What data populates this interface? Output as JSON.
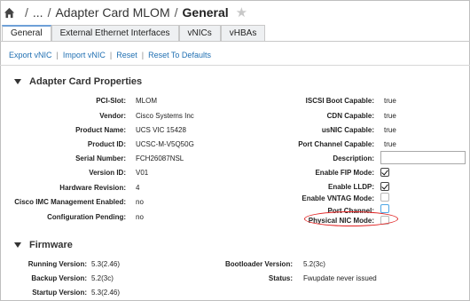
{
  "breadcrumb": {
    "home_icon": "home-icon",
    "ellipsis": "...",
    "parent": "Adapter Card MLOM",
    "current": "General",
    "separator": "/",
    "star_icon": "star-icon"
  },
  "tabs": [
    {
      "label": "General",
      "active": true
    },
    {
      "label": "External Ethernet Interfaces",
      "active": false
    },
    {
      "label": "vNICs",
      "active": false
    },
    {
      "label": "vHBAs",
      "active": false
    }
  ],
  "toolbar": {
    "export": "Export vNIC",
    "import": "Import vNIC",
    "reset": "Reset",
    "reset_defaults": "Reset To Defaults",
    "sep": "|"
  },
  "adapter": {
    "title": "Adapter Card Properties",
    "left": [
      {
        "label": "PCI-Slot:",
        "value": "MLOM"
      },
      {
        "label": "Vendor:",
        "value": "Cisco Systems Inc"
      },
      {
        "label": "Product Name:",
        "value": "UCS VIC 15428"
      },
      {
        "label": "Product ID:",
        "value": "UCSC-M-V5Q50G"
      },
      {
        "label": "Serial Number:",
        "value": "FCH26087NSL"
      },
      {
        "label": "Version ID:",
        "value": "V01"
      },
      {
        "label": "Hardware Revision:",
        "value": "4"
      },
      {
        "label": "Cisco IMC Management Enabled:",
        "value": "no"
      },
      {
        "label": "Configuration Pending:",
        "value": "no"
      }
    ],
    "right_text": [
      {
        "label": "ISCSI Boot Capable:",
        "value": "true"
      },
      {
        "label": "CDN Capable:",
        "value": "true"
      },
      {
        "label": "usNIC Capable:",
        "value": "true"
      },
      {
        "label": "Port Channel Capable:",
        "value": "true"
      }
    ],
    "description_label": "Description:",
    "description_value": "",
    "right_checks": [
      {
        "label": "Enable FIP Mode:",
        "checked": true
      },
      {
        "label": "Enable LLDP:",
        "checked": true
      },
      {
        "label": "Enable VNTAG Mode:",
        "checked": false
      },
      {
        "label": "Port Channel:",
        "checked": false
      },
      {
        "label": "Physical NIC Mode:",
        "checked": false
      }
    ],
    "highlight_color": "#e02020"
  },
  "firmware": {
    "title": "Firmware",
    "left": [
      {
        "label": "Running Version:",
        "value": "5.3(2.46)"
      },
      {
        "label": "Backup Version:",
        "value": "5.2(3c)"
      },
      {
        "label": "Startup Version:",
        "value": "5.3(2.46)"
      }
    ],
    "right": [
      {
        "label": "Bootloader Version:",
        "value": "5.2(3c)"
      },
      {
        "label": "Status:",
        "value": "Fwupdate never issued"
      }
    ]
  },
  "colors": {
    "link": "#1f6fb2",
    "active_tab_accent": "#6ea0d8"
  }
}
